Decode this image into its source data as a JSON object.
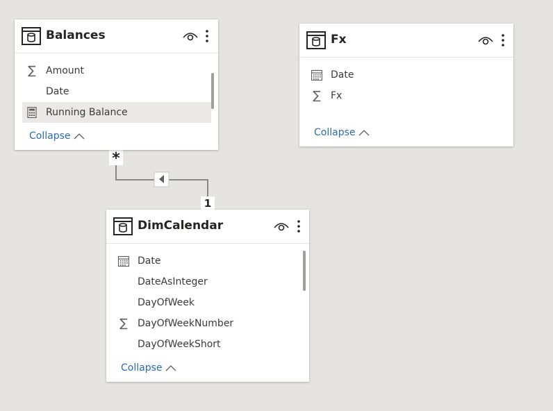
{
  "tables": {
    "balances": {
      "title": "Balances",
      "fields": [
        {
          "label": "Amount",
          "icon": "sigma-icon"
        },
        {
          "label": "Date",
          "icon": ""
        },
        {
          "label": "Running Balance",
          "icon": "calculator-icon",
          "selected": true
        }
      ],
      "collapse_label": "Collapse"
    },
    "fx": {
      "title": "Fx",
      "fields": [
        {
          "label": "Date",
          "icon": "calendar-icon"
        },
        {
          "label": "Fx",
          "icon": "sigma-icon"
        }
      ],
      "collapse_label": "Collapse"
    },
    "dimcalendar": {
      "title": "DimCalendar",
      "fields": [
        {
          "label": "Date",
          "icon": "calendar-icon"
        },
        {
          "label": "DateAsInteger",
          "icon": ""
        },
        {
          "label": "DayOfWeek",
          "icon": ""
        },
        {
          "label": "DayOfWeekNumber",
          "icon": "sigma-icon"
        },
        {
          "label": "DayOfWeekShort",
          "icon": ""
        }
      ],
      "collapse_label": "Collapse"
    }
  },
  "relationship": {
    "from_cardinality": "*",
    "to_cardinality": "1",
    "filter_direction": "single"
  },
  "colors": {
    "canvas": "#e5e4e2",
    "link": "#2b6cb0",
    "connector": "#8a8886"
  }
}
